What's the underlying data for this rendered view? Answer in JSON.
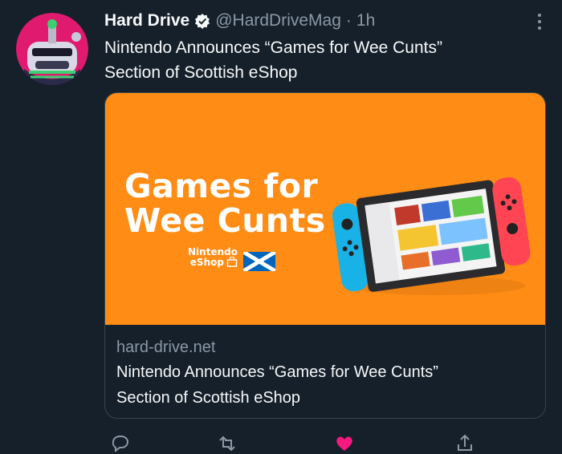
{
  "tweet": {
    "author_name": "Hard Drive",
    "author_handle": "@HardDriveMag",
    "separator": "·",
    "time": "1h",
    "text_lines": [
      "Nintendo Announces “Games for Wee Cunts”",
      "Section of Scottish eShop"
    ]
  },
  "card": {
    "image": {
      "headline_lines": [
        "Games for",
        "Wee Cunts"
      ],
      "logo_lines": [
        "Nintendo",
        "eShop"
      ]
    },
    "domain": "hard-drive.net",
    "title_lines": [
      "Nintendo Announces “Games for Wee Cunts”",
      "Section of Scottish eShop"
    ]
  },
  "icons": {
    "verified": "verified-badge-icon",
    "more": "more-options-icon",
    "reply": "reply-icon",
    "retweet": "retweet-icon",
    "like": "like-icon",
    "share": "share-icon",
    "flag": "scottish-flag-icon",
    "bag": "shopping-bag-icon"
  },
  "colors": {
    "background": "#15202b",
    "card_image": "#ff8c14",
    "muted_text": "#8b98a5",
    "like": "#f91880"
  }
}
